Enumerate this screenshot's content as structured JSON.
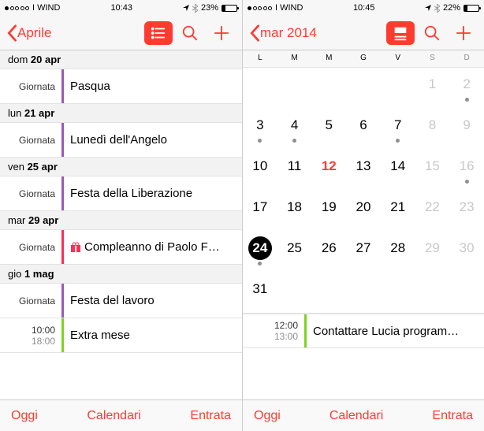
{
  "left": {
    "status": {
      "carrier": "I WIND",
      "time": "10:43",
      "battery": "23%"
    },
    "back": "Aprile",
    "days": [
      {
        "label_pre": "dom ",
        "label_bold": "20 apr",
        "events": [
          {
            "time1": "Giornata",
            "title": "Pasqua",
            "color": "#9b59b6"
          }
        ]
      },
      {
        "label_pre": "lun ",
        "label_bold": "21 apr",
        "events": [
          {
            "time1": "Giornata",
            "title": "Lunedì dell'Angelo",
            "color": "#9b59b6"
          }
        ]
      },
      {
        "label_pre": "ven ",
        "label_bold": "25 apr",
        "events": [
          {
            "time1": "Giornata",
            "title": "Festa della Liberazione",
            "color": "#9b59b6"
          }
        ]
      },
      {
        "label_pre": "mar ",
        "label_bold": "29 apr",
        "events": [
          {
            "time1": "Giornata",
            "title": "Compleanno di Paolo F…",
            "color": "#ff2d55",
            "bday": true
          }
        ]
      },
      {
        "label_pre": "gio ",
        "label_bold": "1 mag",
        "events": [
          {
            "time1": "Giornata",
            "title": "Festa del lavoro",
            "color": "#9b59b6"
          },
          {
            "time1": "10:00",
            "time2": "18:00",
            "title": "Extra mese",
            "color": "#7ed321"
          }
        ]
      }
    ],
    "toolbar": {
      "today": "Oggi",
      "cal": "Calendari",
      "inbox": "Entrata"
    }
  },
  "right": {
    "status": {
      "carrier": "I WIND",
      "time": "10:45",
      "battery": "22%"
    },
    "back": "mar 2014",
    "dow": [
      "L",
      "M",
      "M",
      "G",
      "V",
      "S",
      "D"
    ],
    "grid": [
      [
        null,
        null,
        null,
        null,
        null,
        {
          "n": 1,
          "muted": true
        },
        {
          "n": 2,
          "muted": true,
          "mark": true
        }
      ],
      [
        {
          "n": 3,
          "mark": true
        },
        {
          "n": 4,
          "mark": true
        },
        {
          "n": 5
        },
        {
          "n": 6
        },
        {
          "n": 7,
          "mark": true
        },
        {
          "n": 8,
          "muted": true
        },
        {
          "n": 9,
          "muted": true
        }
      ],
      [
        {
          "n": 10
        },
        {
          "n": 11
        },
        {
          "n": 12,
          "today": true
        },
        {
          "n": 13
        },
        {
          "n": 14
        },
        {
          "n": 15,
          "muted": true
        },
        {
          "n": 16,
          "muted": true,
          "mark": true
        }
      ],
      [
        {
          "n": 17
        },
        {
          "n": 18
        },
        {
          "n": 19
        },
        {
          "n": 20
        },
        {
          "n": 21
        },
        {
          "n": 22,
          "muted": true
        },
        {
          "n": 23,
          "muted": true
        }
      ],
      [
        {
          "n": 24,
          "sel": true,
          "mark": true
        },
        {
          "n": 25
        },
        {
          "n": 26
        },
        {
          "n": 27
        },
        {
          "n": 28
        },
        {
          "n": 29,
          "muted": true
        },
        {
          "n": 30,
          "muted": true
        }
      ],
      [
        {
          "n": 31
        },
        null,
        null,
        null,
        null,
        null,
        null
      ]
    ],
    "event": {
      "time1": "12:00",
      "time2": "13:00",
      "title": "Contattare Lucia program…",
      "color": "#7ed321"
    },
    "toolbar": {
      "today": "Oggi",
      "cal": "Calendari",
      "inbox": "Entrata"
    }
  }
}
